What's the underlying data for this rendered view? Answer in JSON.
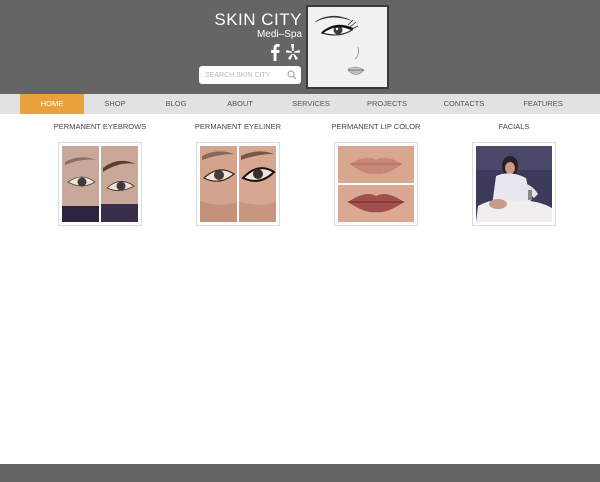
{
  "brand": {
    "title": "SKIN CITY",
    "subtitle": "Medi–Spa"
  },
  "search": {
    "placeholder": "SEARCH SKIN CITY"
  },
  "nav": {
    "items": [
      {
        "label": "HOME",
        "active": true
      },
      {
        "label": "SHOP"
      },
      {
        "label": "BLOG"
      },
      {
        "label": "ABOUT"
      },
      {
        "label": "SERVICES"
      },
      {
        "label": "PROJECTS"
      },
      {
        "label": "CONTACTS"
      },
      {
        "label": "FEATURES"
      }
    ]
  },
  "services": [
    {
      "title": "PERMANENT EYEBROWS"
    },
    {
      "title": "PERMANENT EYELINER"
    },
    {
      "title": "PERMANENT LIP COLOR"
    },
    {
      "title": "FACIALS"
    }
  ],
  "icons": [
    "facebook-icon",
    "yelp-icon",
    "search-icon"
  ],
  "colors": {
    "header": "#656565",
    "nav_bg": "#e2e2e2",
    "active": "#e9a23b",
    "footer": "#656565"
  }
}
